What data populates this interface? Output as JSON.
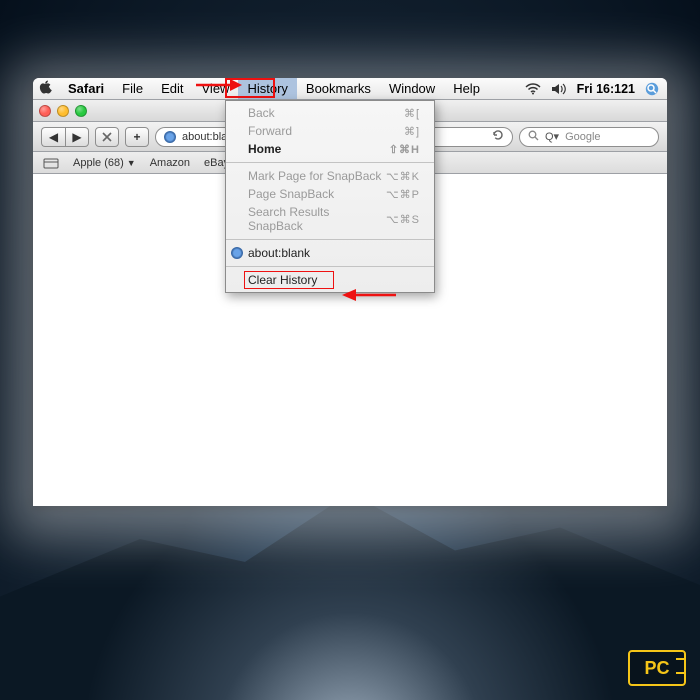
{
  "menubar": {
    "app": "Safari",
    "items": [
      "File",
      "Edit",
      "View",
      "History",
      "Bookmarks",
      "Window",
      "Help"
    ],
    "open_index": 3,
    "clock": "Fri 16:121"
  },
  "toolbar": {
    "address": "about:blank",
    "search_placeholder": "Google"
  },
  "bookmarks_bar": {
    "items": [
      "Apple (68)",
      "Amazon",
      "eBay"
    ]
  },
  "history_menu": {
    "back": {
      "label": "Back",
      "shortcut": "⌘["
    },
    "forward": {
      "label": "Forward",
      "shortcut": "⌘]"
    },
    "home": {
      "label": "Home",
      "shortcut": "⇧⌘H"
    },
    "mark_snapback": {
      "label": "Mark Page for SnapBack",
      "shortcut": "⌥⌘K"
    },
    "page_snapback": {
      "label": "Page SnapBack",
      "shortcut": "⌥⌘P"
    },
    "search_snapback": {
      "label": "Search Results SnapBack",
      "shortcut": "⌥⌘S"
    },
    "recent": {
      "label": "about:blank"
    },
    "clear": {
      "label": "Clear History"
    }
  },
  "annotations": {
    "highlight_menu": "History",
    "highlight_item": "Clear History"
  }
}
